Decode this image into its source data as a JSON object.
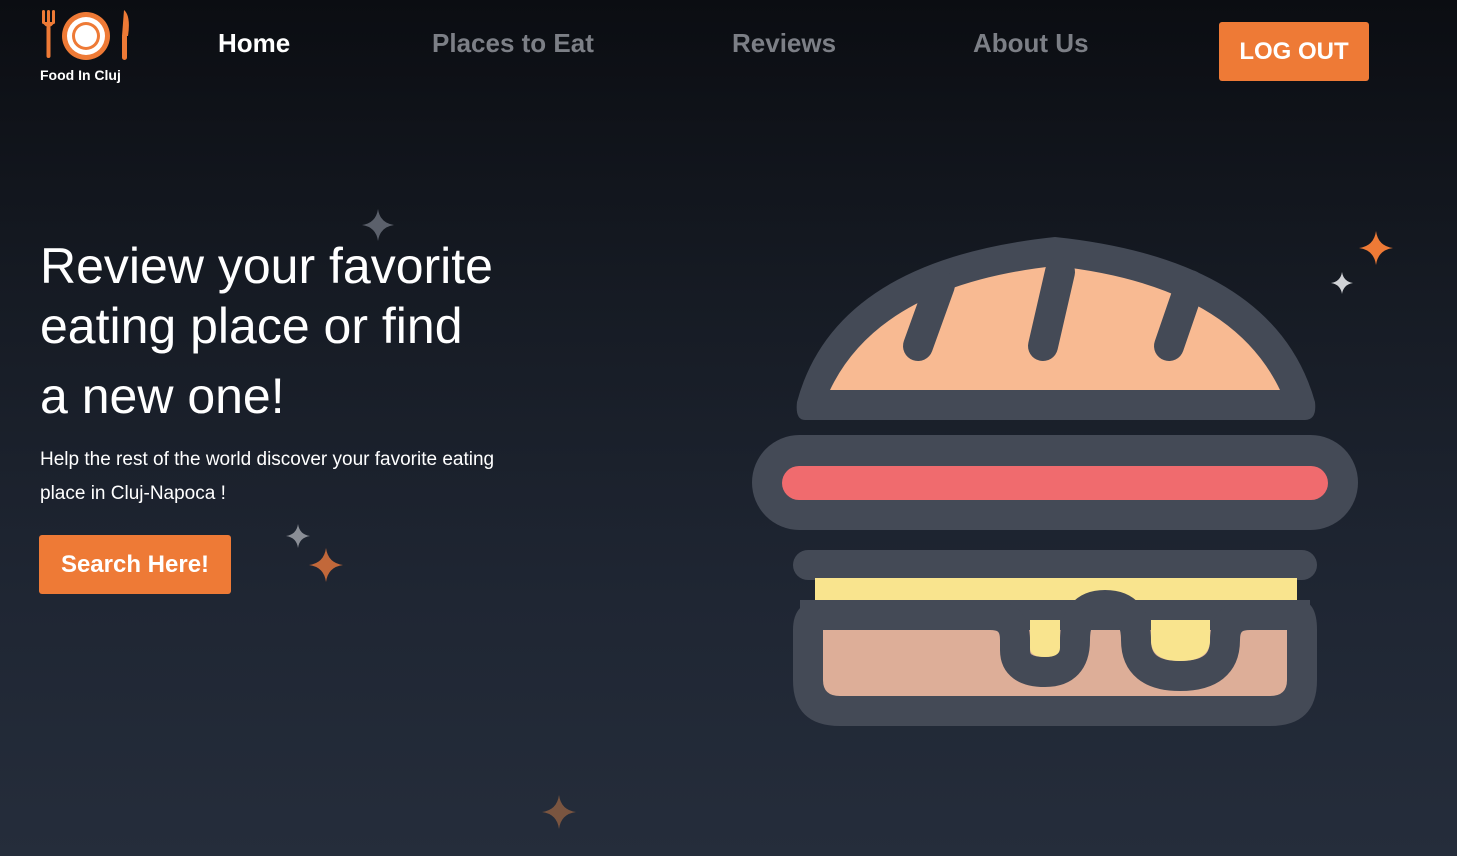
{
  "brand": {
    "name": "Food In Cluj",
    "logo_icon": "plate-fork-knife-icon",
    "accent_color": "#ee7a36"
  },
  "nav": {
    "items": [
      {
        "label": "Home",
        "active": true
      },
      {
        "label": "Places to Eat",
        "active": false
      },
      {
        "label": "Reviews",
        "active": false
      },
      {
        "label": "About Us",
        "active": false
      }
    ],
    "logout_label": "LOG OUT"
  },
  "hero": {
    "title_lines": [
      "Review your favorite",
      "eating place or find",
      "a new one!"
    ],
    "subtitle": "Help the rest of the world discover your favorite eating place in Cluj-Napoca !",
    "cta_label": "Search Here!",
    "illustration": "burger-icon",
    "decoration_icon": "sparkle-icon"
  }
}
